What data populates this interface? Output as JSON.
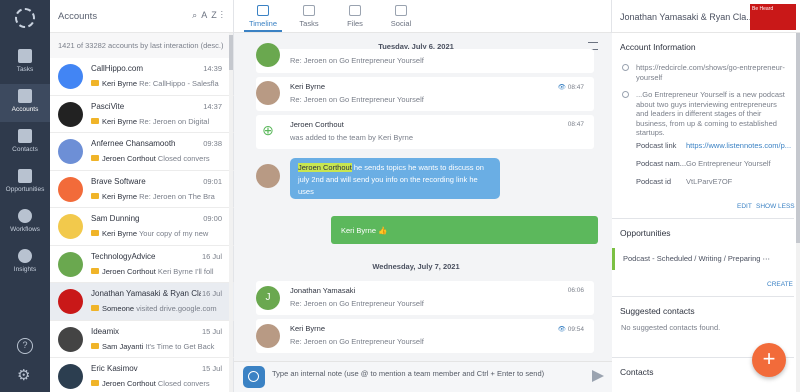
{
  "nav": {
    "items": [
      {
        "label": "Tasks",
        "icon": "check-icon"
      },
      {
        "label": "Accounts",
        "icon": "building-icon"
      },
      {
        "label": "Contacts",
        "icon": "contact-card-icon"
      },
      {
        "label": "Opportunities",
        "icon": "funnel-icon"
      },
      {
        "label": "Workflows",
        "icon": "play-icon"
      },
      {
        "label": "Insights",
        "icon": "chart-icon"
      }
    ],
    "help": "?"
  },
  "accounts": {
    "title": "Accounts",
    "sort_label": "AZ",
    "count_text": "1421 of 33282 accounts by last interaction (desc.)",
    "items": [
      {
        "name": "CallHippo.com",
        "time": "14:39",
        "who": "Keri Byrne",
        "text": "Re: CallHippo - Salesfla",
        "color": "#4285f4"
      },
      {
        "name": "PasciVite",
        "time": "14:37",
        "who": "Keri Byrne",
        "text": "Re: Jeroen on Digital",
        "color": "#222"
      },
      {
        "name": "Anfernee Chansamooth",
        "time": "09:38",
        "who": "Jeroen Corthout",
        "text": "Closed convers",
        "color": "#6d8fd6"
      },
      {
        "name": "Brave Software",
        "time": "09:01",
        "who": "Keri Byrne",
        "text": "Re: Jeroen on The Bra",
        "color": "#f26b3a"
      },
      {
        "name": "Sam Dunning",
        "time": "09:00",
        "who": "Keri Byrne",
        "text": "Your copy of my new",
        "color": "#f2c94c"
      },
      {
        "name": "TechnologyAdvice",
        "time": "16 Jul",
        "who": "Jeroen Corthout",
        "text": "Keri Byrne I'll foll",
        "color": "#6aa84f"
      },
      {
        "name": "Jonathan Yamasaki & Ryan Cla...",
        "time": "16 Jul",
        "who": "Someone",
        "text": "visited drive.google.com",
        "color": "#c91818"
      },
      {
        "name": "Ideamix",
        "time": "15 Jul",
        "who": "Sam Jayanti",
        "text": "It's Time to Get Back",
        "color": "#444"
      },
      {
        "name": "Eric Kasimov",
        "time": "15 Jul",
        "who": "Jeroen Corthout",
        "text": "Closed convers",
        "color": "#2c3e50"
      }
    ]
  },
  "center": {
    "tabs": [
      "Timeline",
      "Tasks",
      "Files",
      "Social"
    ],
    "date1": "Tuesday, July 6, 2021",
    "date2": "Wednesday, July 7, 2021",
    "events": [
      {
        "who": "",
        "what": "Re: Jeroen on Go Entrepreneur Yourself",
        "time": ""
      },
      {
        "who": "Keri Byrne",
        "what": "Re: Jeroen on Go Entrepreneur Yourself",
        "time": "08:47"
      },
      {
        "who": "Jeroen Corthout",
        "what": "was added to the team by Keri Byrne",
        "time": "08:47"
      },
      {
        "who": "Jonathan Yamasaki",
        "what": "Re: Jeroen on Go Entrepreneur Yourself",
        "time": "06:06"
      },
      {
        "who": "Keri Byrne",
        "what": "Re: Jeroen on Go Entrepreneur Yourself",
        "time": "09:54"
      }
    ],
    "bubble": {
      "mention": "Jeroen Corthout",
      "text": " he sends topics he wants to discuss on july 2nd and will send you info on the recording link he uses"
    },
    "green_bubble": "Keri Byrne 👍",
    "composer_placeholder": "Type an internal note (use @ to mention a team member and Ctrl + Enter to send)"
  },
  "right": {
    "header": "Jonathan Yamasaki & Ryan Cla...",
    "thumb_text": "Be Heard",
    "account_info_title": "Account Information",
    "website": "https://redcircle.com/shows/go-entrepreneur-yourself",
    "description": "...Go Entrepreneur Yourself is a new podcast about two guys interviewing entrepreneurs and leaders in different stages of their business, from up & coming to established startups.",
    "fields": [
      {
        "k": "Podcast link",
        "v": "https://www.listennotes.com/p..."
      },
      {
        "k": "Podcast nam...",
        "v": "Go Entrepreneur Yourself"
      },
      {
        "k": "Podcast id",
        "v": "VtLParvE7OF"
      }
    ],
    "edit": "EDIT",
    "show_less": "SHOW LESS",
    "opportunities_title": "Opportunities",
    "opportunity": "Podcast - Scheduled / Writing / Preparing",
    "create": "CREATE",
    "suggested_title": "Suggested contacts",
    "suggested_empty": "No suggested contacts found.",
    "contacts_title": "Contacts",
    "fab": "+"
  }
}
